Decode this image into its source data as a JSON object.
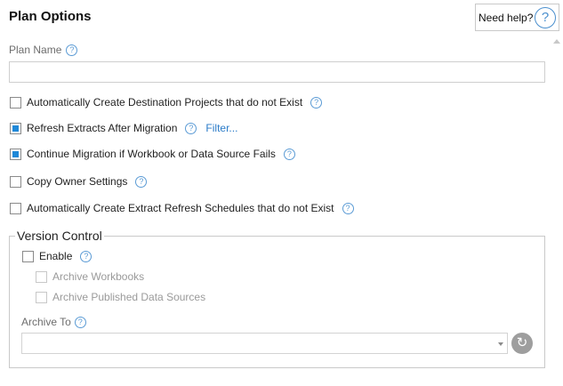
{
  "header": {
    "title": "Plan Options",
    "help_label": "Need help?",
    "help_icon": "question-circle-icon"
  },
  "plan_name": {
    "label": "Plan Name",
    "value": "",
    "placeholder": ""
  },
  "options": {
    "auto_create_projects": {
      "label": "Automatically Create Destination Projects that do not Exist",
      "checked": false
    },
    "refresh_extracts": {
      "label": "Refresh Extracts After Migration",
      "checked": true,
      "link": "Filter..."
    },
    "continue_migration": {
      "label": "Continue Migration if Workbook or Data Source Fails",
      "checked": true
    },
    "copy_owner": {
      "label": "Copy Owner Settings",
      "checked": false
    },
    "auto_create_schedules": {
      "label": "Automatically Create Extract Refresh Schedules that do not Exist",
      "checked": false
    }
  },
  "version_control": {
    "legend": "Version Control",
    "enable": {
      "label": "Enable",
      "checked": false
    },
    "archive_workbooks": {
      "label": "Archive Workbooks",
      "checked": false,
      "disabled": true
    },
    "archive_data_sources": {
      "label": "Archive Published Data Sources",
      "checked": false,
      "disabled": true
    },
    "archive_to": {
      "label": "Archive To",
      "value": ""
    }
  },
  "icons": {
    "help": "?",
    "refresh": "↻"
  },
  "colors": {
    "accent": "#1e88d8",
    "link": "#2a7bc8",
    "help_icon": "#5b9bd5"
  }
}
